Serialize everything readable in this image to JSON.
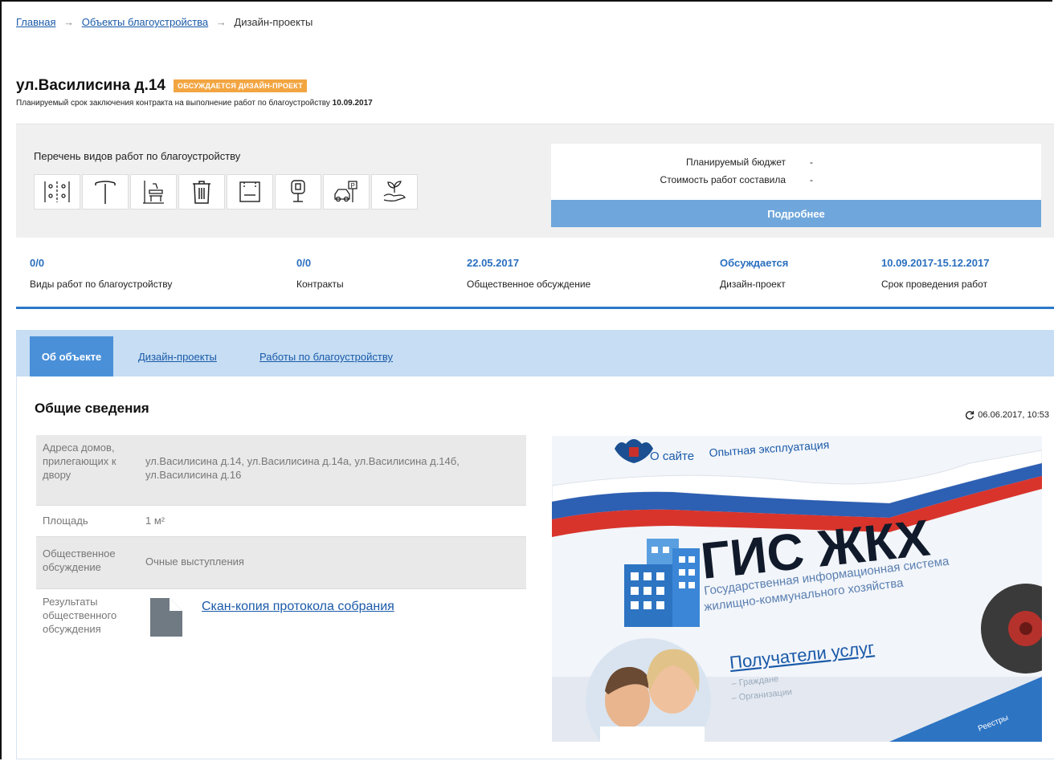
{
  "breadcrumb": {
    "items": [
      "Главная",
      "Объекты благоустройства"
    ],
    "current": "Дизайн-проекты",
    "separator": "→"
  },
  "object": {
    "title": "ул.Василисина д.14",
    "status": "ОБСУЖДАЕТСЯ ДИЗАЙН-ПРОЕКТ",
    "contract_text": "Планируемый срок заключения контракта на выполнение работ по благоустройству",
    "contract_date": "10.09.2017"
  },
  "works": {
    "label": "Перечень видов работ по благоустройству",
    "icons": [
      "lighting-grid-icon",
      "street-lamp-icon",
      "bench-icon",
      "trash-bin-icon",
      "playground-icon",
      "parking-sign-icon",
      "car-parking-icon",
      "greening-plant-icon"
    ]
  },
  "budget": {
    "planned_label": "Планируемый бюджет",
    "planned_value": "-",
    "cost_label": "Стоимость работ составила",
    "cost_value": "-",
    "more_button": "Подробнее"
  },
  "stats": [
    {
      "value": "0/0",
      "label": "Виды работ по благоустройству"
    },
    {
      "value": "0/0",
      "label": "Контракты"
    },
    {
      "value": "22.05.2017",
      "label": "Общественное обсуждение"
    },
    {
      "value": "Обсуждается",
      "label": "Дизайн-проект"
    },
    {
      "value": "10.09.2017-15.12.2017",
      "label": "Срок проведения работ"
    }
  ],
  "tabs": [
    "Об объекте",
    "Дизайн-проекты",
    "Работы по благоустройству"
  ],
  "section": {
    "title": "Общие сведения",
    "updated": "06.06.2017, 10:53"
  },
  "info": {
    "addresses_key": "Адреса домов, прилегающих к двору",
    "addresses_val": "ул.Василисина д.14, ул.Василисина д.14а, ул.Василисина д.14б, ул.Василисина д.16",
    "area_key": "Площадь",
    "area_val": "1 м²",
    "discussion_key": "Общественное обсуждение",
    "discussion_val": "Очные выступления",
    "results_key": "Результаты общественного обсуждения",
    "results_link": "Скан-копия протокола собрания"
  },
  "photo": {
    "nav_about": "О сайте",
    "nav_trial": "Опытная эксплуатация",
    "logo": "ГИС ЖКХ",
    "subtitle_1": "Государственная информационная система",
    "subtitle_2": "жилищно-коммунального хозяйства",
    "recipients": "Получатели услуг",
    "sub_citizens": "– Граждане",
    "sub_orgs": "– Организации",
    "registers": "Реестры"
  },
  "colors": {
    "accent": "#2a78c9",
    "status_badge": "#f2a541",
    "button": "#6fa7dc",
    "tabs_bar": "#c6ddf3"
  }
}
